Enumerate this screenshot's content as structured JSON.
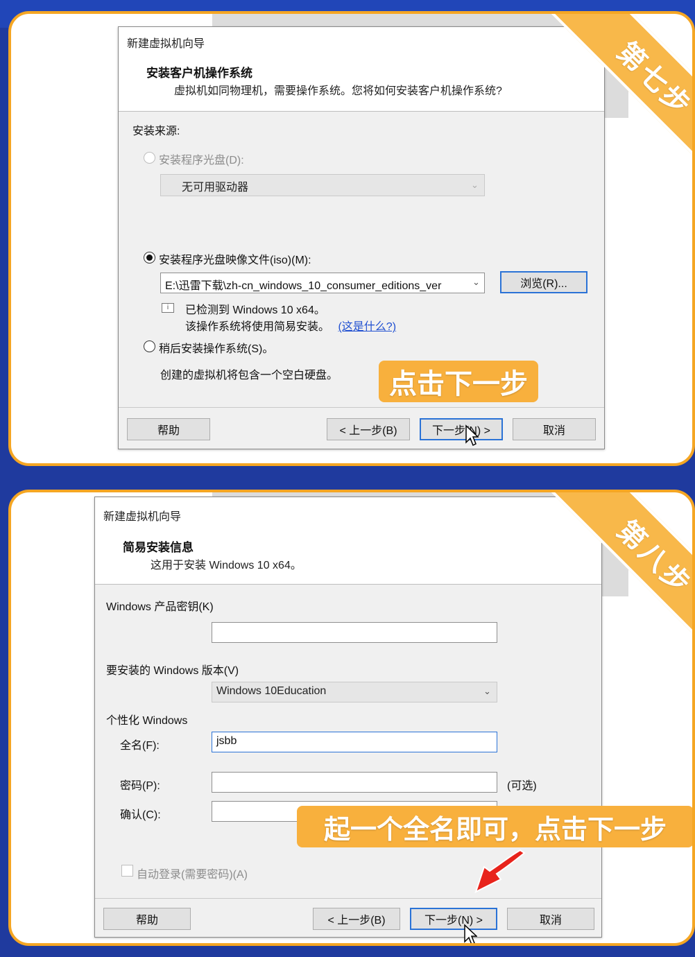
{
  "step7": {
    "ribbon": "第七步",
    "dialog": {
      "title": "新建虚拟机向导",
      "heading": "安装客户机操作系统",
      "subtitle": "虚拟机如同物理机，需要操作系统。您将如何安装客户机操作系统?",
      "source_label": "安装来源:",
      "disc_option": "安装程序光盘(D):",
      "disc_select": "无可用驱动器",
      "iso_option": "安装程序光盘映像文件(iso)(M):",
      "iso_path": "E:\\迅雷下载\\zh-cn_windows_10_consumer_editions_ver",
      "browse_button": "浏览(R)...",
      "detected": "已检测到 Windows 10 x64。",
      "easy_install": "该操作系统将使用简易安装。",
      "whats_this": "(这是什么?)",
      "later_option": "稍后安装操作系统(S)。",
      "later_desc": "创建的虚拟机将包含一个空白硬盘。",
      "help_button": "帮助",
      "back_button": "< 上一步(B)",
      "next_button": "下一步(N) >",
      "cancel_button": "取消"
    },
    "callout": "点击下一步"
  },
  "step8": {
    "ribbon": "第八步",
    "dialog": {
      "title": "新建虚拟机向导",
      "heading": "简易安装信息",
      "subtitle": "这用于安装 Windows 10 x64。",
      "product_key_label": "Windows 产品密钥(K)",
      "product_key_value": "-    -    -    -",
      "version_label": "要安装的 Windows 版本(V)",
      "version_value": "Windows 10Education",
      "personalize_label": "个性化 Windows",
      "fullname_label": "全名(F):",
      "fullname_value": "jsbb",
      "password_label": "密码(P):",
      "optional_label": "(可选)",
      "confirm_label": "确认(C):",
      "autologin_label": "自动登录(需要密码)(A)",
      "help_button": "帮助",
      "back_button": "< 上一步(B)",
      "next_button": "下一步(N) >",
      "cancel_button": "取消"
    },
    "callout": "起一个全名即可，点击下一步"
  },
  "colors": {
    "accent": "#f5a623",
    "background": "#1f3a9e",
    "link": "#1f4fd1"
  }
}
